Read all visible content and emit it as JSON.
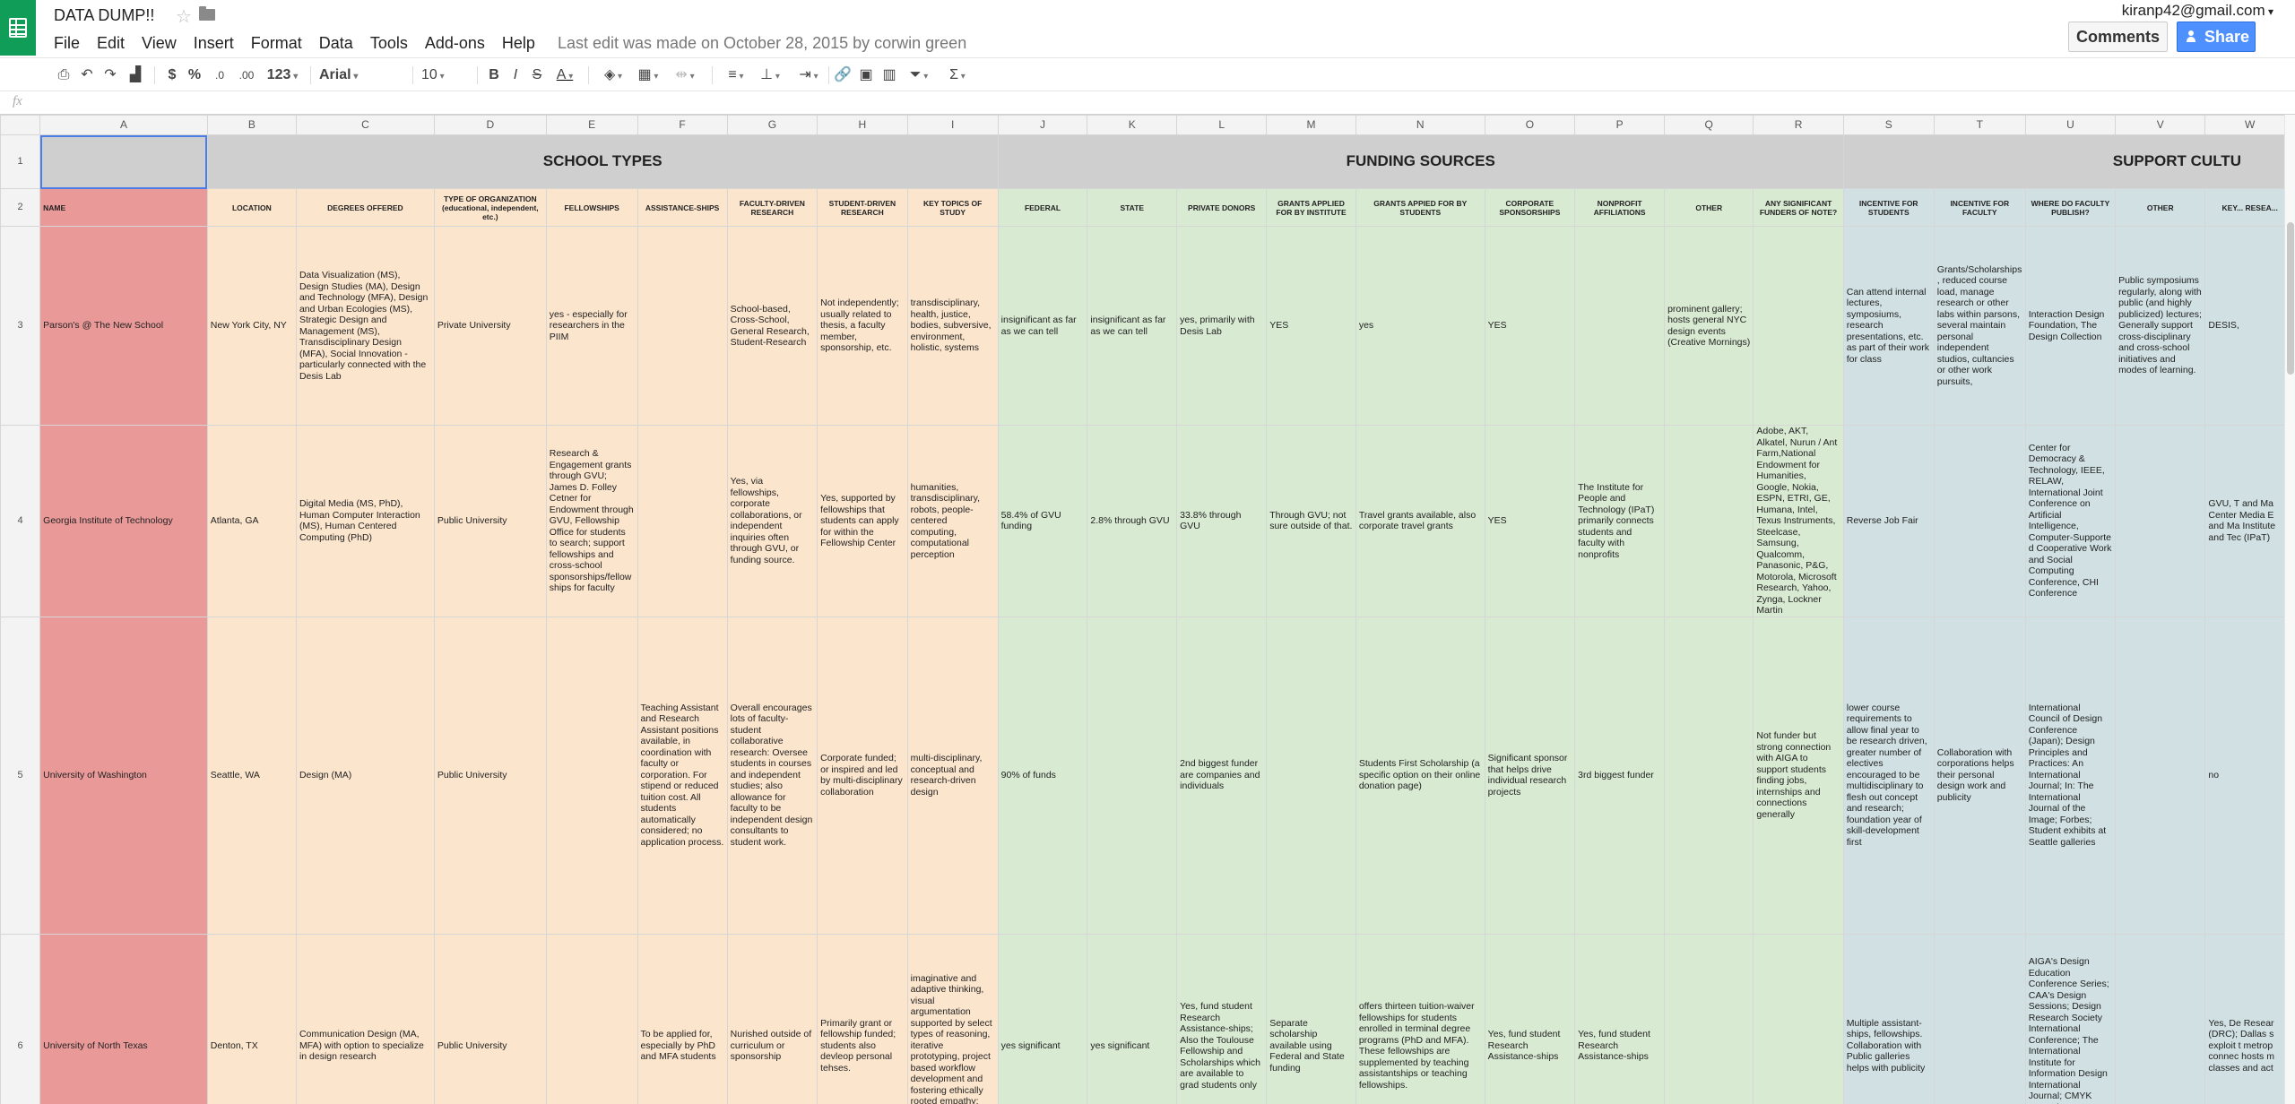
{
  "app": {
    "title": "DATA DUMP!!",
    "account": "kiranp42@gmail.com",
    "comments_label": "Comments",
    "share_label": "Share",
    "last_edit": "Last edit was made on October 28, 2015 by corwin green"
  },
  "menu": [
    "File",
    "Edit",
    "View",
    "Insert",
    "Format",
    "Data",
    "Tools",
    "Add-ons",
    "Help"
  ],
  "toolbar": {
    "currency": "$",
    "percent": "%",
    "decimals_less": ".0",
    "decimals_more": ".00",
    "format_more": "123",
    "font": "Arial",
    "font_size": "10",
    "bold": "B",
    "italic": "I",
    "strike": "S",
    "text_color": "A",
    "functions": "Σ"
  },
  "formula": {
    "fx": "fx",
    "value": ""
  },
  "columns": [
    "A",
    "B",
    "C",
    "D",
    "E",
    "F",
    "G",
    "H",
    "I",
    "J",
    "K",
    "L",
    "M",
    "N",
    "O",
    "P",
    "Q",
    "R",
    "S",
    "T",
    "U",
    "V",
    "W"
  ],
  "rows": {
    "r1": {
      "num": "1",
      "school_types": "SCHOOL TYPES",
      "funding_sources": "FUNDING SOURCES",
      "support_culture": "SUPPORT CULTU"
    },
    "r2": {
      "num": "2",
      "cells": [
        "NAME",
        "LOCATION",
        "DEGREES OFFERED",
        "TYPE OF ORGANIZATION (educational, independent, etc.)",
        "FELLOWSHIPS",
        "ASSISTANCE-SHIPS",
        "FACULTY-DRIVEN RESEARCH",
        "STUDENT-DRIVEN RESEARCH",
        "KEY TOPICS OF STUDY",
        "FEDERAL",
        "STATE",
        "PRIVATE DONORS",
        "GRANTS APPLIED FOR BY INSTITUTE",
        "GRANTS APPIED FOR BY STUDENTS",
        "CORPORATE SPONSORSHIPS",
        "NONPROFIT AFFILIATIONS",
        "OTHER",
        "ANY SIGNIFICANT FUNDERS OF NOTE?",
        "INCENTIVE FOR STUDENTS",
        "INCENTIVE FOR FACULTY",
        "WHERE DO FACULTY PUBLISH?",
        "OTHER",
        "KEY... RESEA..."
      ]
    },
    "r3": {
      "num": "3",
      "cells": [
        "Parson's @ The New School",
        "New York City, NY",
        "Data Visualization (MS), Design Studies (MA), Design and Technology (MFA), Design and Urban Ecologies (MS), Strategic Design and Management (MS), Transdisciplinary Design (MFA), Social Innovation - particularly connected with the Desis Lab",
        "Private University",
        "yes - especially for researchers in the PIIM",
        "",
        "School-based, Cross-School, General Research, Student-Research",
        "Not independently; usually related to thesis, a faculty member, sponsorship, etc.",
        "transdisciplinary, health, justice, bodies, subversive, environment, holistic, systems",
        "insignificant as far as we can tell",
        "insignificant as far as we can tell",
        "yes, primarily with Desis Lab",
        "YES",
        "yes",
        "YES",
        "",
        "prominent gallery; hosts general NYC design events (Creative Mornings)",
        "",
        "Can attend internal lectures, symposiums, research presentations, etc. as part of their work for class",
        "Grants/Scholarships , reduced course load, manage research or other labs within parsons, several maintain personal independent studios, cultancies or other work pursuits,",
        "Interaction Design Foundation, The Design Collection",
        "Public symposiums regularly, along with public (and highly publicized) lectures; Generally support cross-disciplinary and cross-school initiatives and modes of learning.",
        "DESIS,"
      ]
    },
    "r4": {
      "num": "4",
      "cells": [
        "Georgia Institute of Technology",
        "Atlanta, GA",
        "Digital Media (MS, PhD), Human Computer Interaction (MS), Human Centered Computing (PhD)",
        "Public University",
        "Research & Engagement grants through GVU; James D. Folley Cetner for Endowment through GVU, Fellowship Office for students to search; support fellowships and cross-school sponsorships/fellow ships for faculty",
        "",
        "Yes, via fellowships, corporate collaborations, or independent inquiries often through GVU, or funding source.",
        "Yes, supported by fellowships that students can apply for within the Fellowship Center",
        "humanities, transdisciplinary, robots, people-centered computing, computational perception",
        "58.4% of GVU funding",
        "2.8% through GVU",
        "33.8% through GVU",
        "Through GVU; not sure outside of that.",
        "Travel grants available, also corporate travel grants",
        "YES",
        "The Institute for People and Technology (IPaT) primarily connects students and faculty with nonprofits",
        "",
        "Adobe, AKT, Alkatel, Nurun / Ant Farm,National Endowment for Humanities, Google, Nokia, ESPN, ETRI, GE, Humana, Intel, Texus Instruments, Steelcase, Samsung, Qualcomm, Panasonic, P&G, Motorola, Microsoft Research, Yahoo, Zynga, Lockner Martin",
        "Reverse Job Fair",
        "",
        "Center for Democracy & Technology, IEEE, RELAW, International Joint Conference on Artificial Intelligence, Computer-Supporte d Cooperative Work and Social Computing Conference, CHI Conference",
        "",
        "GVU, T and Ma Center Media E and Ma Institute and Tec (IPaT)"
      ]
    },
    "r5": {
      "num": "5",
      "cells": [
        "University of Washington",
        "Seattle, WA",
        "Design (MA)",
        "Public University",
        "",
        "Teaching Assistant and Research Assistant positions available, in coordination with faculty or corporation. For stipend or reduced tuition cost. All students automatically considered; no application process.",
        "Overall encourages lots of faculty-student collaborative research: Oversee students in courses and independent studies; also allowance for faculty to be independent design consultants to student work.",
        "Corporate funded; or inspired and led by multi-disciplinary collaboration",
        "multi-disciplinary, conceptual and research-driven design",
        "90% of funds",
        "",
        "2nd biggest funder are companies and individuals",
        "",
        "Students First Scholarship (a specific option on their online donation page)",
        "Significant sponsor that helps drive individual research projects",
        "3rd biggest funder",
        "",
        "Not funder but strong connection with AIGA to support students finding jobs, internships and connections generally",
        "lower course requirements to allow final year to be research driven, greater number of electives encouraged to be multidisciplinary to flesh out concept and research; foundation year of skill-development first",
        "Collaboration with corporations helps their personal design work and publicity",
        "International Council of Design Conference (Japan); Design Principles and Practices: An International Journal; In: The International Journal of the Image; Forbes; Student exhibits at Seattle galleries",
        "",
        "no"
      ]
    },
    "r6": {
      "num": "6",
      "cells": [
        "University of North Texas",
        "Denton, TX",
        "Communication Design (MA, MFA) with option to specialize in design research",
        "Public University",
        "",
        "To be applied for, especially by PhD and MFA students",
        "Nurished outside of curriculum or sponsorship",
        "Primarily grant or fellowship funded; students also devleop personal tehses.",
        "imaginative and adaptive thinking, visual argumentation supported by select types of reasoning, iterative prototyping, project based workflow development and fostering ethically rooted empathy; failure",
        "yes significant",
        "yes significant",
        "Yes, fund student Research Assistance-ships; Also the Toulouse Fellowship and Scholarships which are available to grad students only",
        "Separate scholarship available using Federal and State funding",
        "offers thirteen tuition-waiver fellowships for students enrolled in terminal degree programs (PhD and MFA). These fellowships are supplemented by teaching assistantships or teaching fellowships.",
        "Yes, fund student Research Assistance-ships",
        "Yes, fund student Research Assistance-ships",
        "",
        "",
        "Multiple assistant-ships, fellowships. Collaboration with Public galleries helps with publicity",
        "",
        "AIGA's Design Education Conference Series; CAA's Design Sessions; Design Research Society International Conference; The International Institute for Information Design International Journal; CMYK Magazine; ADC Young Gun; FPO Awards",
        "",
        "Yes, De Resear (DRC); Dallas s exploit t metrop connec hosts m classes and act"
      ]
    }
  },
  "colors": {
    "name": "#ea9999",
    "school": "#fce5cd",
    "funding": "#d9ead3",
    "support": "#d0e0e3",
    "header": "#cfcfcf"
  }
}
